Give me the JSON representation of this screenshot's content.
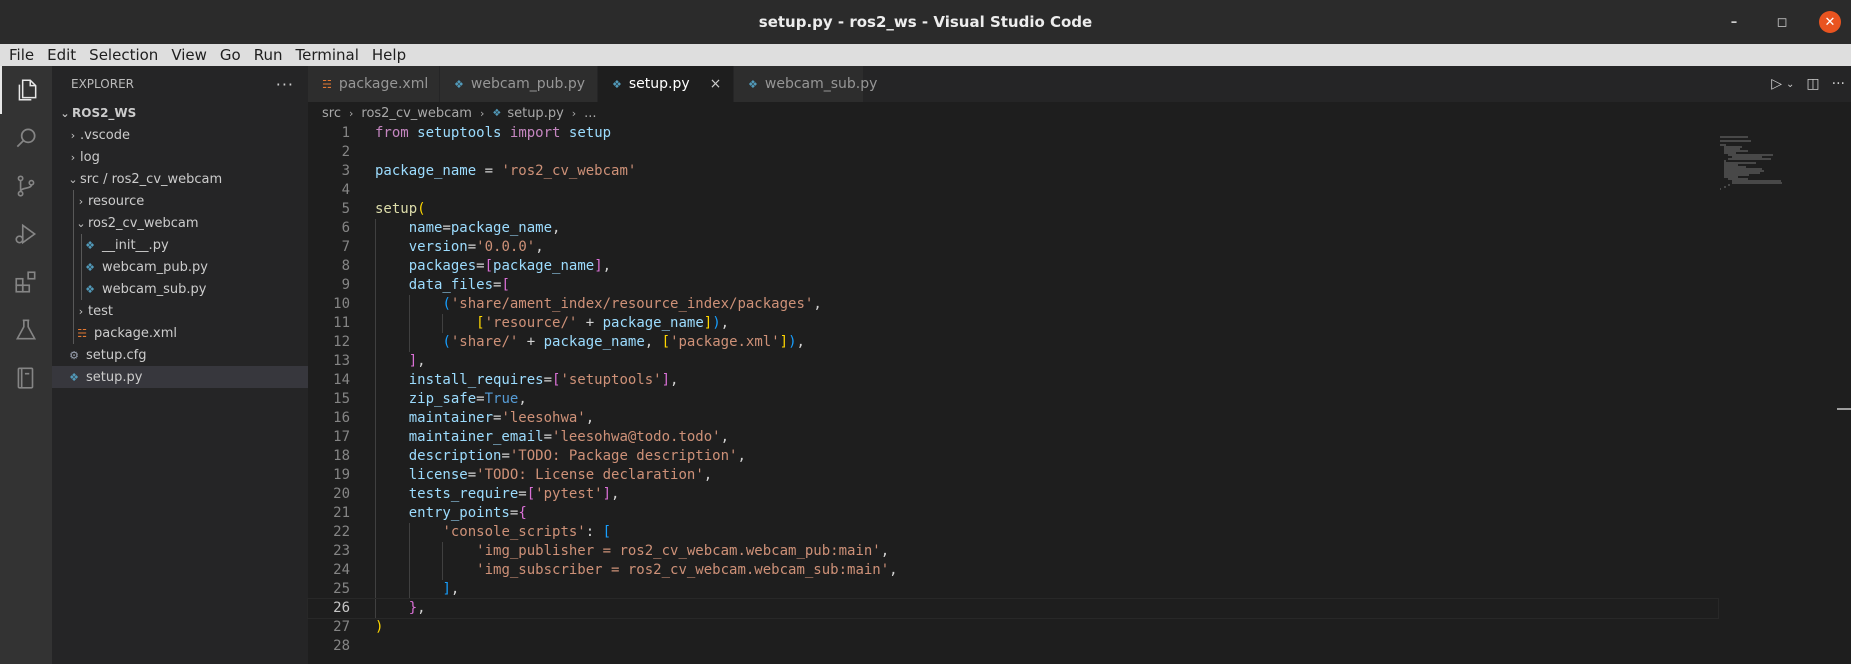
{
  "window": {
    "title": "setup.py - ros2_ws - Visual Studio Code",
    "minimize_icon": "minimize-icon",
    "maximize_icon": "maximize-icon",
    "close_icon": "close-icon"
  },
  "menubar": [
    "File",
    "Edit",
    "Selection",
    "View",
    "Go",
    "Run",
    "Terminal",
    "Help"
  ],
  "activitybar": [
    "explorer-icon",
    "search-icon",
    "source-control-icon",
    "run-debug-icon",
    "extensions-icon",
    "testing-icon",
    "remote-explorer-icon"
  ],
  "sidebar": {
    "title": "EXPLORER",
    "more": "···",
    "tree": [
      {
        "label": "ROS2_WS",
        "type": "root",
        "chevron": "⌄"
      },
      {
        "label": ".vscode",
        "type": "folder",
        "chevron": "›"
      },
      {
        "label": "log",
        "type": "folder",
        "chevron": "›"
      },
      {
        "label": "src / ros2_cv_webcam",
        "type": "folder-open",
        "chevron": "⌄"
      },
      {
        "label": "resource",
        "type": "folder",
        "chevron": "›"
      },
      {
        "label": "ros2_cv_webcam",
        "type": "folder-open",
        "chevron": "⌄"
      },
      {
        "label": "__init__.py",
        "type": "py"
      },
      {
        "label": "webcam_pub.py",
        "type": "py"
      },
      {
        "label": "webcam_sub.py",
        "type": "py"
      },
      {
        "label": "test",
        "type": "folder",
        "chevron": "›"
      },
      {
        "label": "package.xml",
        "type": "xml"
      },
      {
        "label": "setup.cfg",
        "type": "cfg"
      },
      {
        "label": "setup.py",
        "type": "py",
        "selected": true
      }
    ]
  },
  "tabs": [
    {
      "label": "package.xml",
      "icon": "xml"
    },
    {
      "label": "webcam_pub.py",
      "icon": "py"
    },
    {
      "label": "setup.py",
      "icon": "py",
      "active": true,
      "close": "×"
    },
    {
      "label": "webcam_sub.py",
      "icon": "py"
    }
  ],
  "breadcrumb": [
    "src",
    "ros2_cv_webcam",
    "setup.py",
    "..."
  ],
  "code": {
    "current_line": 26,
    "lines": [
      "from setuptools import setup",
      "",
      "package_name = 'ros2_cv_webcam'",
      "",
      "setup(",
      "    name=package_name,",
      "    version='0.0.0',",
      "    packages=[package_name],",
      "    data_files=[",
      "        ('share/ament_index/resource_index/packages',",
      "            ['resource/' + package_name]),",
      "        ('share/' + package_name, ['package.xml']),",
      "    ],",
      "    install_requires=['setuptools'],",
      "    zip_safe=True,",
      "    maintainer='leesohwa',",
      "    maintainer_email='leesohwa@todo.todo',",
      "    description='TODO: Package description',",
      "    license='TODO: License declaration',",
      "    tests_require=['pytest'],",
      "    entry_points={",
      "        'console_scripts': [",
      "            'img_publisher = ros2_cv_webcam.webcam_pub:main',",
      "            'img_subscriber = ros2_cv_webcam.webcam_sub:main',",
      "        ],",
      "    },",
      ")",
      ""
    ]
  },
  "colors": {
    "keyword": "#569cd6",
    "control": "#c586c0",
    "string": "#ce9178",
    "variable": "#9cdcfe",
    "function": "#dcdcaa",
    "bracket1": "#ffd700",
    "bracket2": "#da70d6",
    "bracket3": "#179fff"
  }
}
